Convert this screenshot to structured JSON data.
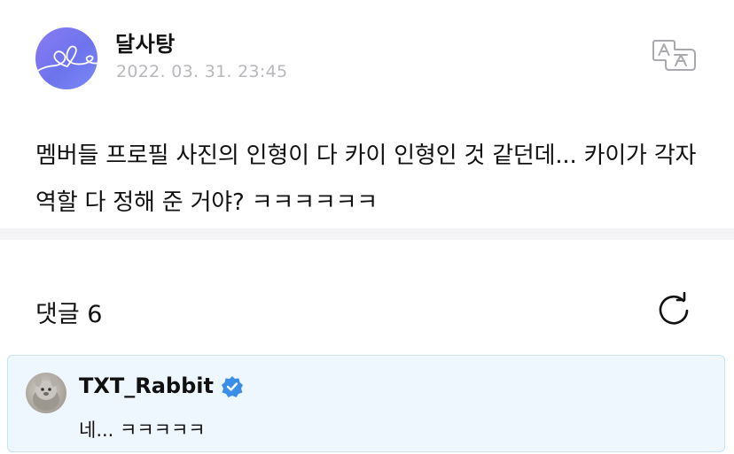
{
  "post": {
    "author": "달사탕",
    "timestamp": "2022. 03. 31. 23:45",
    "body": "멤버들 프로필 사진의 인형이 다 카이 인형인 것 같던데... 카이가 각자 역할 다 정해 준 거야? ㅋㅋㅋㅋㅋㅋ",
    "avatar_icon": "heart-scribble-icon",
    "translate_icon": "translate-icon"
  },
  "comments": {
    "title": "댓글 6",
    "refresh_icon": "refresh-icon",
    "items": [
      {
        "author": "TXT_Rabbit",
        "verified_icon": "verified-badge-icon",
        "text": "네... ㅋㅋㅋㅋㅋ"
      }
    ]
  },
  "colors": {
    "avatar_gradient": "#7b78f0",
    "timestamp": "#b8b8bd",
    "divider": "#f4f4f6",
    "comment_bg": "#eef7fe",
    "comment_border": "#c8e2f7",
    "verified_blue": "#3a8ee8"
  }
}
